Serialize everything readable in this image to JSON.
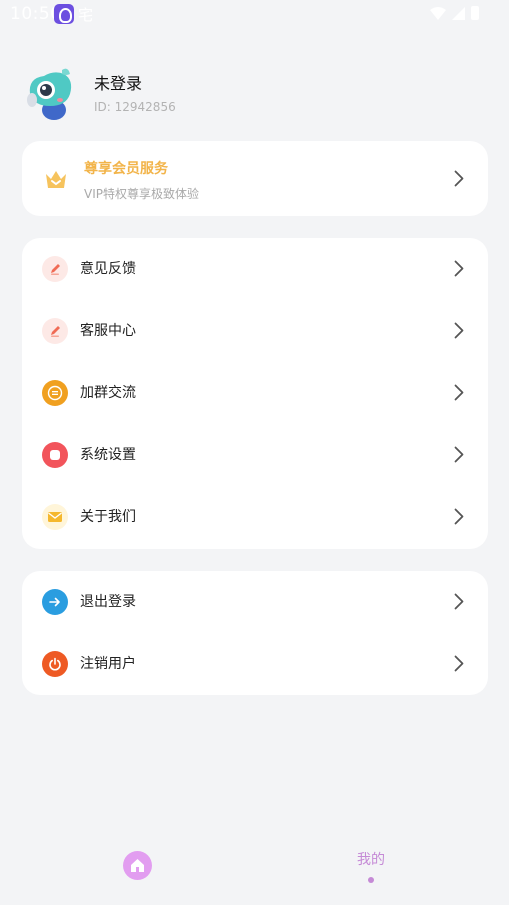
{
  "status_bar": {
    "time": "10:50",
    "app_text": "宅",
    "icons": [
      "wifi-icon",
      "signal-icon",
      "battery-icon"
    ]
  },
  "profile": {
    "name": "未登录",
    "id_text": "ID: 12942856"
  },
  "vip": {
    "title": "尊享会员服务",
    "subtitle": "VIP特权尊享极致体验",
    "icon": "crown-icon"
  },
  "menu": [
    {
      "label": "意见反馈",
      "icon": "pencil-icon",
      "color": "#f06b55"
    },
    {
      "label": "客服中心",
      "icon": "pencil-icon",
      "color": "#f06b55"
    },
    {
      "label": "加群交流",
      "icon": "chat-icon",
      "color": "#f0a020"
    },
    {
      "label": "系统设置",
      "icon": "settings-square-icon",
      "color": "#f2545b"
    },
    {
      "label": "关于我们",
      "icon": "mail-icon",
      "color": "#f5b82e"
    }
  ],
  "actions": [
    {
      "label": "退出登录",
      "icon": "arrow-right-icon",
      "color": "#2a9de0"
    },
    {
      "label": "注销用户",
      "icon": "power-icon",
      "color": "#ee5a24"
    }
  ],
  "bottom_nav": {
    "home_icon": "home-icon",
    "mine_label": "我的",
    "accent": "#c58ad6"
  }
}
